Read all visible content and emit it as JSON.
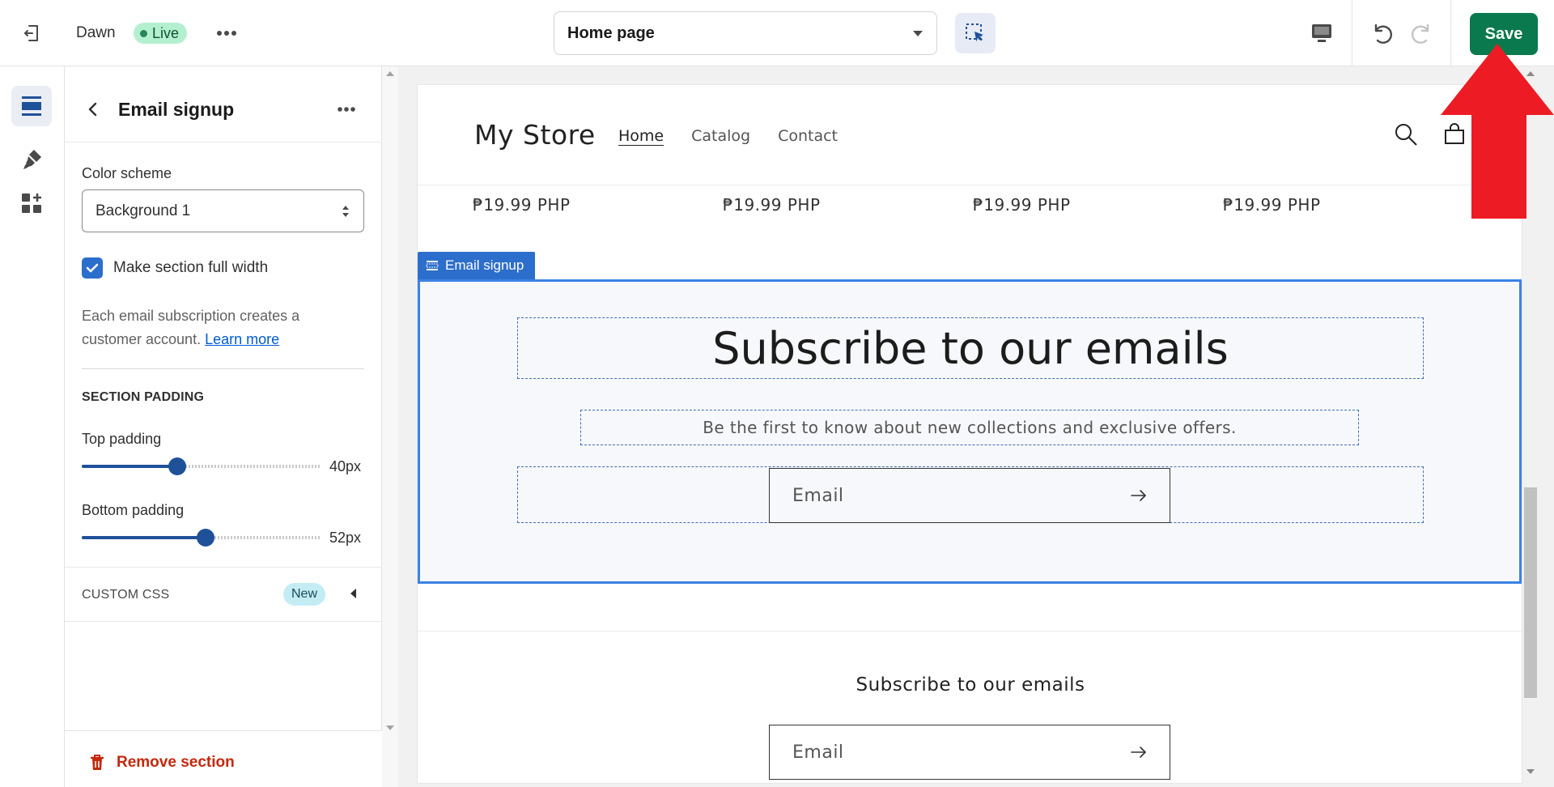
{
  "topbar": {
    "theme_name": "Dawn",
    "live_label": "Live",
    "page_select_label": "Home page",
    "save_label": "Save"
  },
  "panel": {
    "title": "Email signup",
    "color_scheme_label": "Color scheme",
    "color_scheme_value": "Background 1",
    "full_width_label": "Make section full width",
    "full_width_checked": true,
    "info_text": "Each email subscription creates a customer account.",
    "learn_more_label": "Learn more",
    "section_padding_heading": "SECTION PADDING",
    "top_padding_label": "Top padding",
    "top_padding_value": "40px",
    "top_padding_fraction": 0.4,
    "bottom_padding_label": "Bottom padding",
    "bottom_padding_value": "52px",
    "bottom_padding_fraction": 0.52,
    "custom_css_label": "CUSTOM CSS",
    "new_badge": "New",
    "remove_section_label": "Remove section"
  },
  "preview": {
    "store_name": "My Store",
    "nav": [
      "Home",
      "Catalog",
      "Contact"
    ],
    "prices": [
      "₱19.99 PHP",
      "₱19.99 PHP",
      "₱19.99 PHP",
      "₱19.99 PHP"
    ],
    "section_tag": "Email signup",
    "heading": "Subscribe to our emails",
    "subheading": "Be the first to know about new collections and exclusive offers.",
    "email_placeholder": "Email",
    "footer_title": "Subscribe to our emails",
    "footer_email_placeholder": "Email"
  },
  "colors": {
    "save_button": "#0a7a4e",
    "accent": "#2c6ecb",
    "slider": "#1f5199",
    "remove": "#c5280c",
    "annotation_arrow": "#ed1c24"
  },
  "icons": {
    "exit": "exit-icon",
    "more": "more-horizontal-icon",
    "inspector": "inspector-icon",
    "desktop": "desktop-icon",
    "undo": "undo-icon",
    "redo": "redo-icon",
    "sections": "sections-icon",
    "theme_settings": "paintbrush-icon",
    "apps": "apps-icon",
    "back": "chevron-left-icon",
    "remove": "trash-icon",
    "search": "search-icon",
    "cart": "cart-icon",
    "submit": "arrow-right-icon"
  }
}
